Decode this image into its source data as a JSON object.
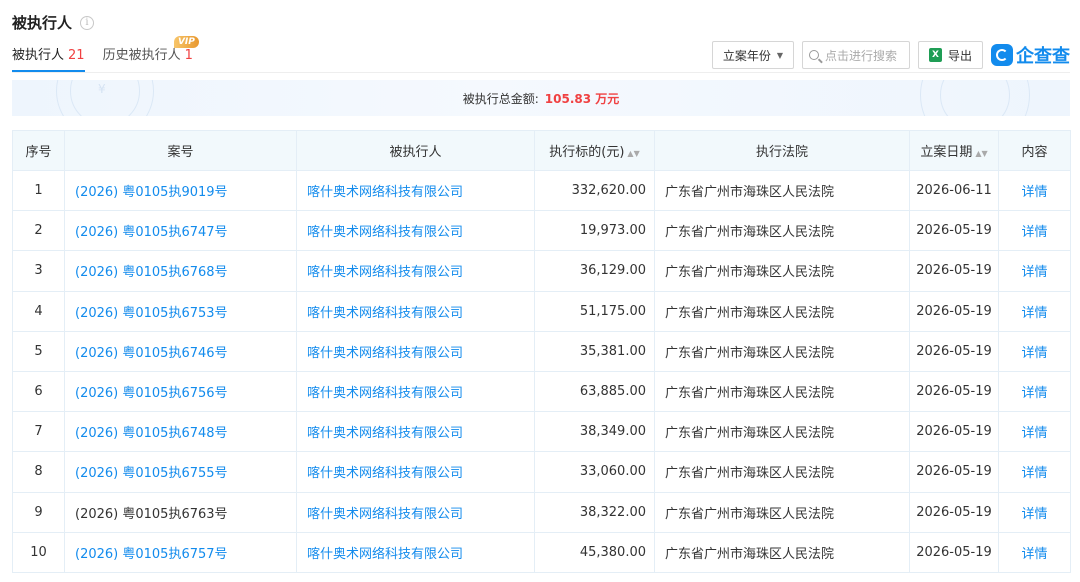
{
  "section": {
    "title": "被执行人"
  },
  "tabs": [
    {
      "label": "被执行人",
      "count": "21"
    },
    {
      "label": "历史被执行人",
      "count": "1",
      "badge": "VIP"
    }
  ],
  "toolbar": {
    "year_label": "立案年份",
    "search_placeholder": "点击进行搜索",
    "export_label": "导出",
    "logo_text": "企查查"
  },
  "summary": {
    "label": "被执行总金额:",
    "amount": "105.83 万元"
  },
  "table": {
    "headers": {
      "index": "序号",
      "case": "案号",
      "executed": "被执行人",
      "target": "执行标的(元)",
      "court": "执行法院",
      "date": "立案日期",
      "content": "内容"
    },
    "rows": [
      {
        "index": "1",
        "case": "(2026) 粤0105执9019号",
        "executed": "喀什奥术网络科技有限公司",
        "target": "332,620.00",
        "court": "广东省广州市海珠区人民法院",
        "date": "2026-06-11",
        "content": "详情",
        "case_link": true
      },
      {
        "index": "2",
        "case": "(2026) 粤0105执6747号",
        "executed": "喀什奥术网络科技有限公司",
        "target": "19,973.00",
        "court": "广东省广州市海珠区人民法院",
        "date": "2026-05-19",
        "content": "详情",
        "case_link": true
      },
      {
        "index": "3",
        "case": "(2026) 粤0105执6768号",
        "executed": "喀什奥术网络科技有限公司",
        "target": "36,129.00",
        "court": "广东省广州市海珠区人民法院",
        "date": "2026-05-19",
        "content": "详情",
        "case_link": true
      },
      {
        "index": "4",
        "case": "(2026) 粤0105执6753号",
        "executed": "喀什奥术网络科技有限公司",
        "target": "51,175.00",
        "court": "广东省广州市海珠区人民法院",
        "date": "2026-05-19",
        "content": "详情",
        "case_link": true
      },
      {
        "index": "5",
        "case": "(2026) 粤0105执6746号",
        "executed": "喀什奥术网络科技有限公司",
        "target": "35,381.00",
        "court": "广东省广州市海珠区人民法院",
        "date": "2026-05-19",
        "content": "详情",
        "case_link": true
      },
      {
        "index": "6",
        "case": "(2026) 粤0105执6756号",
        "executed": "喀什奥术网络科技有限公司",
        "target": "63,885.00",
        "court": "广东省广州市海珠区人民法院",
        "date": "2026-05-19",
        "content": "详情",
        "case_link": true
      },
      {
        "index": "7",
        "case": "(2026) 粤0105执6748号",
        "executed": "喀什奥术网络科技有限公司",
        "target": "38,349.00",
        "court": "广东省广州市海珠区人民法院",
        "date": "2026-05-19",
        "content": "详情",
        "case_link": true
      },
      {
        "index": "8",
        "case": "(2026) 粤0105执6755号",
        "executed": "喀什奥术网络科技有限公司",
        "target": "33,060.00",
        "court": "广东省广州市海珠区人民法院",
        "date": "2026-05-19",
        "content": "详情",
        "case_link": true
      },
      {
        "index": "9",
        "case": "(2026) 粤0105执6763号",
        "executed": "喀什奥术网络科技有限公司",
        "target": "38,322.00",
        "court": "广东省广州市海珠区人民法院",
        "date": "2026-05-19",
        "content": "详情",
        "case_link": false
      },
      {
        "index": "10",
        "case": "(2026) 粤0105执6757号",
        "executed": "喀什奥术网络科技有限公司",
        "target": "45,380.00",
        "court": "广东省广州市海珠区人民法院",
        "date": "2026-05-19",
        "content": "详情",
        "case_link": true
      }
    ]
  }
}
